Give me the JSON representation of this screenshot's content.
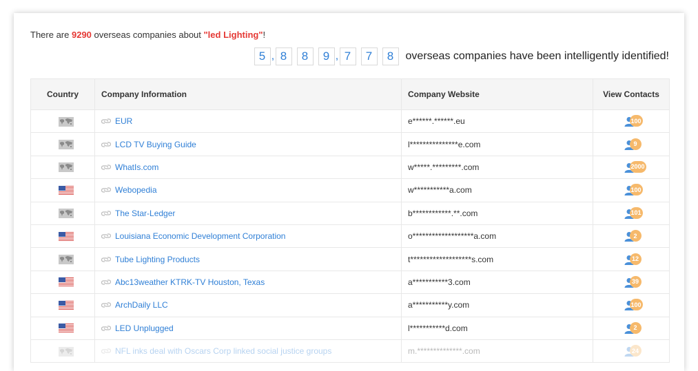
{
  "summary": {
    "prefix": "There are ",
    "count": "9290",
    "middle": " overseas companies about ",
    "keyword": "\"led Lighting\"",
    "suffix": "!"
  },
  "ticker": {
    "digits": [
      "5",
      "8",
      "8",
      "9",
      "7",
      "7",
      "8"
    ],
    "comma": ",",
    "text": "overseas companies have been intelligently identified!"
  },
  "table": {
    "headers": {
      "country": "Country",
      "company": "Company Information",
      "website": "Company Website",
      "contacts": "View Contacts"
    },
    "rows": [
      {
        "flag": "world-map-icon",
        "name": "EUR",
        "website": "e******.******.eu",
        "contacts": "100"
      },
      {
        "flag": "world-map-icon",
        "name": "LCD TV Buying Guide",
        "website": "l***************e.com",
        "contacts": "9"
      },
      {
        "flag": "world-map-icon",
        "name": "WhatIs.com",
        "website": "w*****.*********.com",
        "contacts": "2000"
      },
      {
        "flag": "us-flag-icon",
        "name": "Webopedia",
        "website": "w***********a.com",
        "contacts": "100"
      },
      {
        "flag": "world-map-icon",
        "name": "The Star-Ledger",
        "website": "b************.**.com",
        "contacts": "101"
      },
      {
        "flag": "us-flag-icon",
        "name": "Louisiana Economic Development Corporation",
        "website": "o*******************a.com",
        "contacts": "2"
      },
      {
        "flag": "world-map-icon",
        "name": "Tube Lighting Products",
        "website": "t*******************s.com",
        "contacts": "12"
      },
      {
        "flag": "us-flag-icon",
        "name": "Abc13weather KTRK-TV Houston, Texas",
        "website": "a***********3.com",
        "contacts": "39"
      },
      {
        "flag": "us-flag-icon",
        "name": "ArchDaily LLC",
        "website": "a***********y.com",
        "contacts": "100"
      },
      {
        "flag": "us-flag-icon",
        "name": "LED Unplugged",
        "website": "l***********d.com",
        "contacts": "2"
      },
      {
        "flag": "world-map-icon",
        "name": "NFL inks deal with Oscars Corp linked social justice groups",
        "website": "m.**************.com",
        "contacts": "24"
      }
    ]
  },
  "colors": {
    "accent_blue": "#2f7fd6",
    "highlight_red": "#e53935",
    "badge_orange": "#f6b96b",
    "header_bg": "#f5f5f5"
  }
}
